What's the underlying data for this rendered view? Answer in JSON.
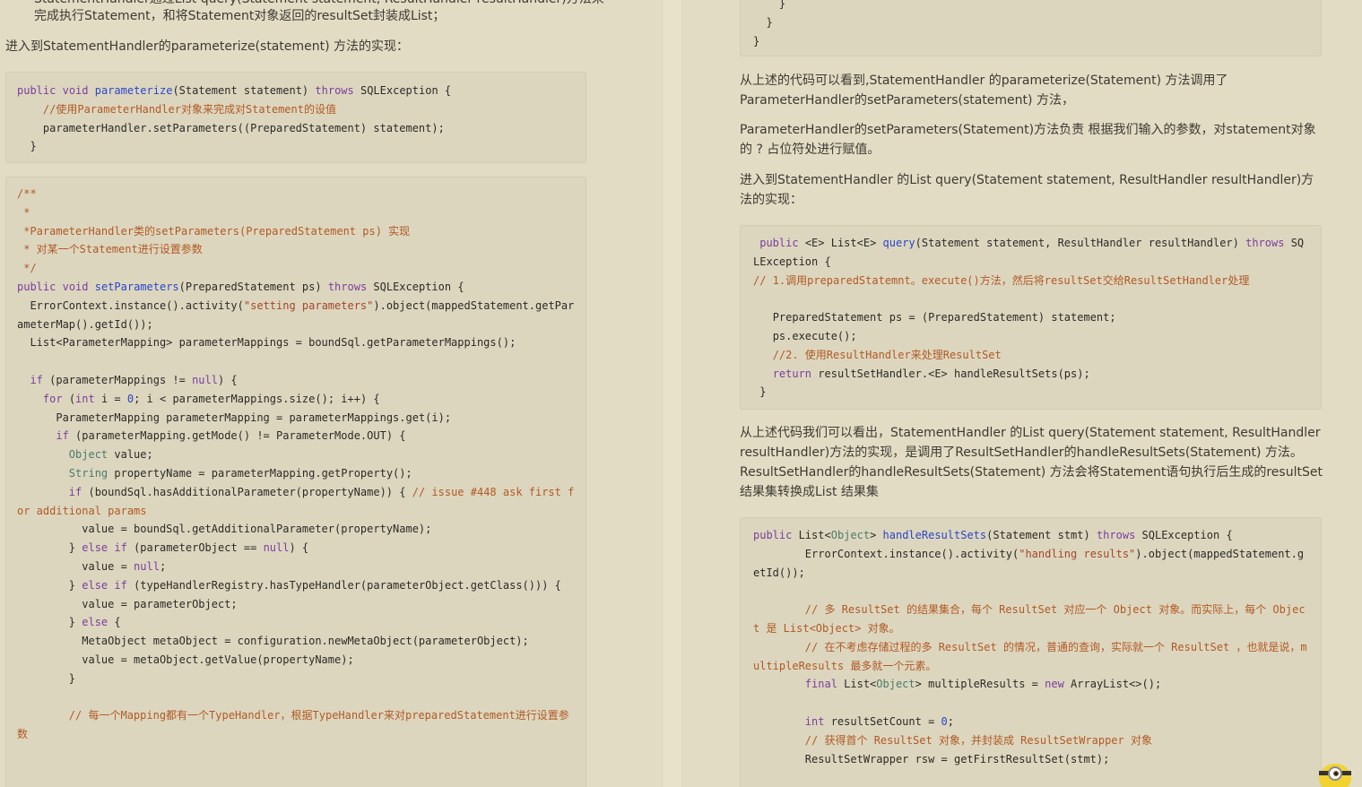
{
  "left": {
    "top_bullet_cut": "StatementHandler通过List query(Statement statement, ResultHandler resultHandler)方法来",
    "top_bullet_line2": "完成执行Statement，和将Statement对象返回的resultSet封装成List；",
    "intro": "进入到StatementHandler的parameterize(statement) 方法的实现：",
    "code1": [
      "public void parameterize(Statement statement) throws SQLException {",
      "    //使用ParameterHandler对象来完成对Statement的设值",
      "    parameterHandler.setParameters((PreparedStatement) statement);",
      "  }"
    ],
    "code2": [
      "/**",
      " *",
      " *ParameterHandler类的setParameters(PreparedStatement ps) 实现",
      " * 对某一个Statement进行设置参数",
      " */",
      "public void setParameters(PreparedStatement ps) throws SQLException {",
      "  ErrorContext.instance().activity(\"setting parameters\").object(mappedStatement.getParameterMap().getId());",
      "  List<ParameterMapping> parameterMappings = boundSql.getParameterMappings();",
      "",
      "  if (parameterMappings != null) {",
      "    for (int i = 0; i < parameterMappings.size(); i++) {",
      "      ParameterMapping parameterMapping = parameterMappings.get(i);",
      "      if (parameterMapping.getMode() != ParameterMode.OUT) {",
      "        Object value;",
      "        String propertyName = parameterMapping.getProperty();",
      "        if (boundSql.hasAdditionalParameter(propertyName)) { // issue #448 ask first for additional params",
      "          value = boundSql.getAdditionalParameter(propertyName);",
      "        } else if (parameterObject == null) {",
      "          value = null;",
      "        } else if (typeHandlerRegistry.hasTypeHandler(parameterObject.getClass())) {",
      "          value = parameterObject;",
      "        } else {",
      "          MetaObject metaObject = configuration.newMetaObject(parameterObject);",
      "          value = metaObject.getValue(propertyName);",
      "        }",
      "",
      "        // 每一个Mapping都有一个TypeHandler，根据TypeHandler来对preparedStatement进行设置参数"
    ]
  },
  "right": {
    "code_tail": [
      "    }",
      "  }",
      "}"
    ],
    "p1": "从上述的代码可以看到,StatementHandler 的parameterize(Statement) 方法调用了ParameterHandler的setParameters(statement) 方法，",
    "p2": "ParameterHandler的setParameters(Statement)方法负责 根据我们输入的参数，对statement对象的 ? 占位符处进行赋值。",
    "p3": "进入到StatementHandler 的List query(Statement statement, ResultHandler resultHandler)方法的实现：",
    "code3": [
      " public <E> List<E> query(Statement statement, ResultHandler resultHandler) throws SQLException {",
      "// 1.调用preparedStatemnt。execute()方法，然后将resultSet交给ResultSetHandler处理",
      "",
      "   PreparedStatement ps = (PreparedStatement) statement;",
      "   ps.execute();",
      "   //2. 使用ResultHandler来处理ResultSet",
      "   return resultSetHandler.<E> handleResultSets(ps);",
      " }"
    ],
    "p4": "从上述代码我们可以看出，StatementHandler 的List query(Statement statement, ResultHandler resultHandler)方法的实现，是调用了ResultSetHandler的handleResultSets(Statement) 方法。ResultSetHandler的handleResultSets(Statement) 方法会将Statement语句执行后生成的resultSet 结果集转换成List 结果集",
    "code4": [
      "public List<Object> handleResultSets(Statement stmt) throws SQLException {",
      "        ErrorContext.instance().activity(\"handling results\").object(mappedStatement.getId());",
      "",
      "        // 多 ResultSet 的结果集合，每个 ResultSet 对应一个 Object 对象。而实际上，每个 Object 是 List<Object> 对象。",
      "        // 在不考虑存储过程的多 ResultSet 的情况，普通的查询，实际就一个 ResultSet ，也就是说，multipleResults 最多就一个元素。",
      "        final List<Object> multipleResults = new ArrayList<>();",
      "",
      "        int resultSetCount = 0;",
      "        // 获得首个 ResultSet 对象，并封装成 ResultSetWrapper 对象",
      "        ResultSetWrapper rsw = getFirstResultSet(stmt);"
    ]
  },
  "colors": {
    "page_bg": "#e3dcc4",
    "code_bg": "#ddd6bf",
    "keyword": "#7a3e9d",
    "function": "#2a46c8",
    "comment": "#b05a24",
    "string": "#a5462a",
    "type": "#4a7a6b"
  },
  "icons": {
    "mascot": "minion-mascot-icon"
  }
}
